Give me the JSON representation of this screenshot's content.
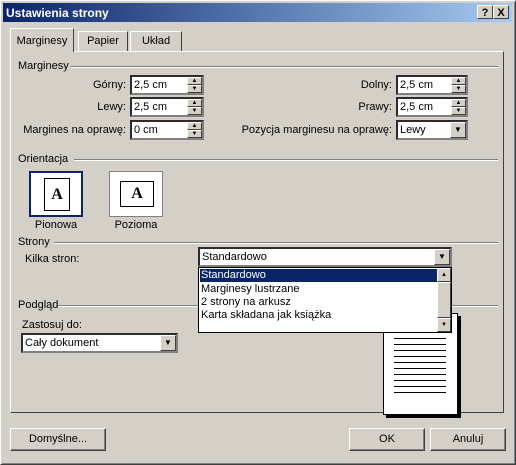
{
  "window": {
    "title": "Ustawienia strony",
    "help_button": "?",
    "close_button": "X"
  },
  "tabs": [
    {
      "label": "Marginesy",
      "active": true
    },
    {
      "label": "Papier",
      "active": false
    },
    {
      "label": "Układ",
      "active": false
    }
  ],
  "margins": {
    "group_label": "Marginesy",
    "top_label": "Górny:",
    "top_value": "2,5 cm",
    "bottom_label": "Dolny:",
    "bottom_value": "2,5 cm",
    "left_label": "Lewy:",
    "left_value": "2,5 cm",
    "right_label": "Prawy:",
    "right_value": "2,5 cm",
    "gutter_label": "Margines na oprawę:",
    "gutter_value": "0 cm",
    "gutter_pos_label": "Pozycja marginesu na oprawę:",
    "gutter_pos_value": "Lewy"
  },
  "orientation": {
    "group_label": "Orientacja",
    "portrait_label": "Pionowa",
    "landscape_label": "Pozioma",
    "icon_letter": "A",
    "selected": "portrait"
  },
  "pages": {
    "group_label": "Strony",
    "multiple_label": "Kilka stron:",
    "selected_value": "Standardowo",
    "options": [
      "Standardowo",
      "Marginesy lustrzane",
      "2 strony na arkusz",
      "Karta składana jak książka"
    ]
  },
  "preview": {
    "group_label": "Podgląd",
    "apply_label": "Zastosuj do:",
    "apply_value": "Cały dokument"
  },
  "buttons": {
    "default_label": "Domyślne...",
    "ok_label": "OK",
    "cancel_label": "Anuluj"
  },
  "colors": {
    "titlebar_start": "#0a246a",
    "selection": "#0a246a",
    "dialog_bg": "#d4d0c8"
  }
}
